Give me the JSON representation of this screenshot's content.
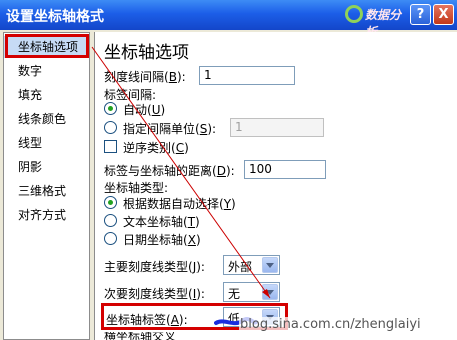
{
  "window": {
    "title": "设置坐标轴格式",
    "help_label": "?",
    "close_label": "X"
  },
  "watermark": {
    "text": "数据分析"
  },
  "nav": {
    "items": [
      {
        "label": "坐标轴选项"
      },
      {
        "label": "数字"
      },
      {
        "label": "填充"
      },
      {
        "label": "线条颜色"
      },
      {
        "label": "线型"
      },
      {
        "label": "阴影"
      },
      {
        "label": "三维格式"
      },
      {
        "label": "对齐方式"
      }
    ],
    "selected_index": 0
  },
  "axis": {
    "section_title": "坐标轴选项",
    "tick_interval": {
      "label": "刻度线间隔",
      "key": "B",
      "value": "1"
    },
    "label_interval": {
      "label": "标签间隔:",
      "auto": {
        "label": "自动",
        "key": "U",
        "checked": true
      },
      "unit": {
        "label": "指定间隔单位",
        "key": "S",
        "value": "1",
        "checked": false
      }
    },
    "reverse": {
      "label": "逆序类别",
      "key": "C",
      "checked": false
    },
    "label_distance": {
      "label": "标签与坐标轴的距离",
      "key": "D",
      "value": "100"
    },
    "axis_type": {
      "label": "坐标轴类型:",
      "options": [
        {
          "label": "根据数据自动选择",
          "key": "Y",
          "checked": true
        },
        {
          "label": "文本坐标轴",
          "key": "T",
          "checked": false
        },
        {
          "label": "日期坐标轴",
          "key": "X",
          "checked": false
        }
      ]
    },
    "major_tick": {
      "label": "主要刻度线类型",
      "key": "J",
      "value": "外部"
    },
    "minor_tick": {
      "label": "次要刻度线类型",
      "key": "I",
      "value": "无"
    },
    "axis_labels": {
      "label": "坐标轴标签",
      "key": "A",
      "value": "低"
    },
    "partial": {
      "label": "横坐标轴交叉"
    }
  },
  "site_watermark": "blog.sina.com.cn/zhenglaiyi"
}
